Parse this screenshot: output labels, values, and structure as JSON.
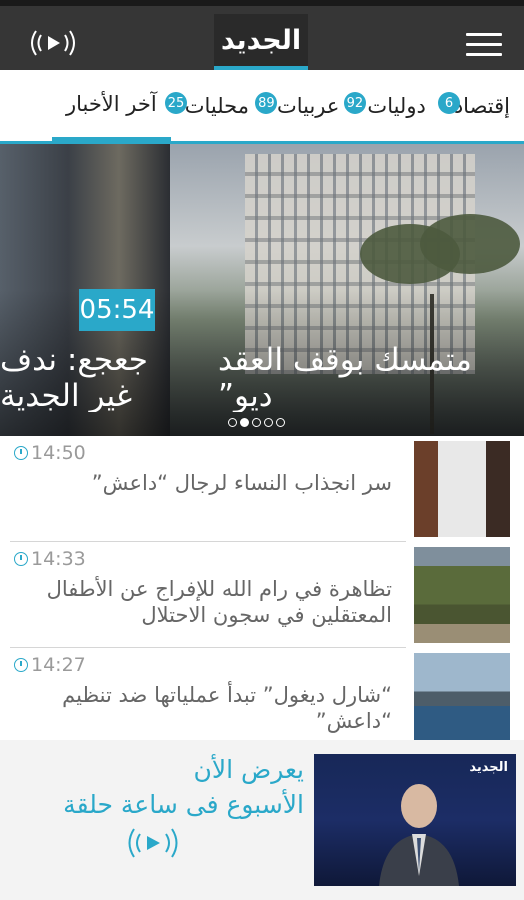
{
  "header": {
    "logo_text": "الجديد",
    "live_icon": "live-broadcast-play-icon",
    "menu_icon": "hamburger-menu-icon"
  },
  "tabs": [
    {
      "label": "آخر الأخبار",
      "badge": "",
      "active": true
    },
    {
      "label": "محليات",
      "badge": "25",
      "active": false
    },
    {
      "label": "عربيات",
      "badge": "89",
      "active": false
    },
    {
      "label": "دوليات",
      "badge": "92",
      "active": false
    },
    {
      "label": "إقتصاد",
      "badge": "6",
      "active": false
    }
  ],
  "hero": {
    "left_title": "جعجع: ندف\nغير الجدية",
    "right_title": "متمسك بوقف العقد\nديو”",
    "duration": "05:54",
    "dots_count": 5,
    "active_dot": 2
  },
  "news": [
    {
      "time": "14:50",
      "title": "سر انجذاب النساء لرجال “داعش”"
    },
    {
      "time": "14:33",
      "title": "تظاهرة في رام الله للإفراج عن الأطفال المعتقلين في سجون الاحتلال"
    },
    {
      "time": "14:27",
      "title": "“شارل ديغول” تبدأ عملياتها ضد تنظيم “داعش”"
    }
  ],
  "promo": {
    "line1": "يعرض الأن",
    "line2": "الأسبوع فى ساعة حلقة",
    "thumb_logo": "الجديد",
    "play_icon": "live-broadcast-play-icon"
  },
  "colors": {
    "accent": "#2aa8c9",
    "topbar": "#363636"
  }
}
